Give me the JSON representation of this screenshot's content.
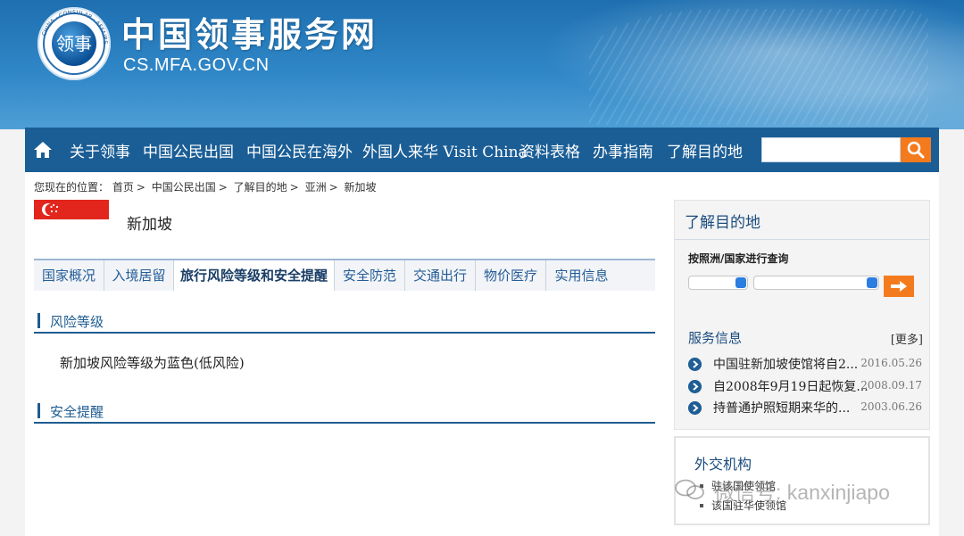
{
  "header": {
    "title": "中国领事服务网",
    "url": "CS.MFA.GOV.CN",
    "logo_center_text": "领事",
    "logo_ring_text": "CHINA · CONSULAR · AFFAIRS"
  },
  "nav": {
    "items": [
      "关于领事",
      "中国公民出国",
      "中国公民在海外",
      "外国人来华 Visit China",
      "资料表格",
      "办事指南",
      "了解目的地"
    ],
    "search_placeholder": ""
  },
  "breadcrumb": {
    "prefix": "您现在的位置：",
    "items": [
      "首页",
      "中国公民出国",
      "了解目的地",
      "亚洲",
      "新加坡"
    ]
  },
  "country": {
    "name": "新加坡"
  },
  "tabs": [
    "国家概况",
    "入境居留",
    "旅行风险等级和安全提醒",
    "安全防范",
    "交通出行",
    "物价医疗",
    "实用信息"
  ],
  "active_tab": "旅行风险等级和安全提醒",
  "sections": {
    "risk_title": "风险等级",
    "risk_text": "新加坡风险等级为蓝色(低风险)",
    "safety_title": "安全提醒"
  },
  "sidebar": {
    "destination_title": "了解目的地",
    "query_label": "按照洲/国家进行查询",
    "service_title": "服务信息",
    "more": "[更多]",
    "news": [
      {
        "title": "中国驻新加坡使馆将自2...",
        "date": "2016.05.26"
      },
      {
        "title": "自2008年9月19日起恢复...",
        "date": "2008.09.17"
      },
      {
        "title": "持普通护照短期来华的...",
        "date": "2003.06.26"
      }
    ],
    "diplomatic_title": "外交机构",
    "diplomatic_links": [
      "驻该国使领馆",
      "该国驻华使领馆"
    ]
  },
  "watermark": "微信号: kanxinjiapo",
  "colors": {
    "nav_bg": "#1b5e96",
    "accent_orange": "#f37b1d",
    "link_blue": "#1e5c91",
    "flag_red": "#e2261d"
  }
}
